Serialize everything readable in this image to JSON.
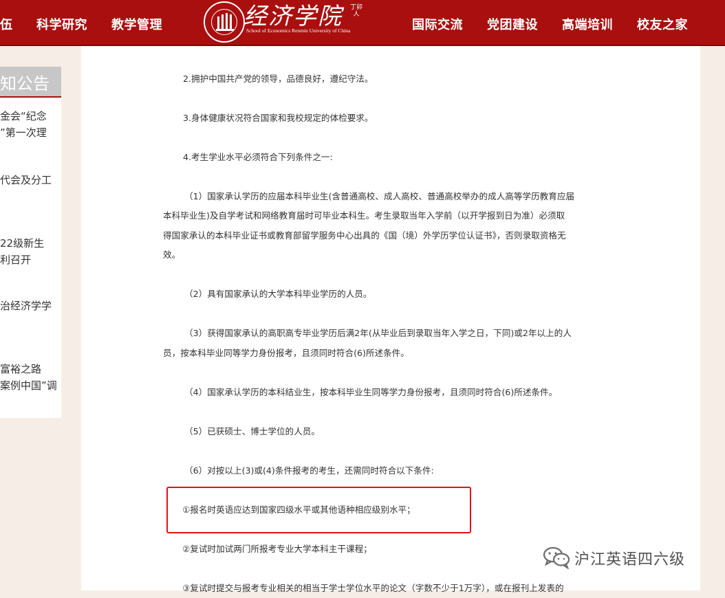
{
  "header": {
    "nav_left": [
      "伍",
      "科学研究",
      "教学管理"
    ],
    "nav_right": [
      "国际交流",
      "党团建设",
      "高端培训",
      "校友之家"
    ],
    "logo_title": "经济学院",
    "logo_subtitle": "School of Economics Renmin University of China",
    "logo_seal": "丁卯人",
    "colors": {
      "brand": "#a90f0f",
      "background": "#f6eee6"
    }
  },
  "sidebar": {
    "heading": "知公告",
    "items": [
      [
        "金会“纪念",
        "”第一次理"
      ],
      [
        "代会及分工"
      ],
      [
        "22级新生",
        "利召开"
      ],
      [
        "治经济学学"
      ],
      [
        "富裕之路",
        "案例中国”调"
      ]
    ]
  },
  "article": {
    "paragraphs": [
      [
        "2.拥护中国共产党的领导，品德良好，遵纪守法。"
      ],
      [
        "3.身体健康状况符合国家和我校规定的体检要求。"
      ],
      [
        "4.考生学业水平必须符合下列条件之一:"
      ],
      [
        "（1）国家承认学历的应届本科毕业生(含普通高校、成人高校、普通高校举办的成人高等学历教育应届",
        "本科毕业生)及自学考试和网络教育届时可毕业本科生。考生录取当年入学前（以开学报到日为准）必须取",
        "得国家承认的本科毕业证书或教育部留学服务中心出具的《国（境）外学历学位认证书》，否则录取资格无",
        "效。"
      ],
      [
        "（2）具有国家承认的大学本科毕业学历的人员。"
      ],
      [
        "（3）获得国家承认的高职高专毕业学历后满2年(从毕业后到录取当年入学之日，下同)或2年以上的人",
        "员，按本科毕业同等学力身份报考，且须同时符合(6)所述条件。"
      ],
      [
        "（4）国家承认学历的本科结业生，按本科毕业生同等学力身份报考，且须同时符合(6)所述条件。"
      ],
      [
        "（5）已获硕士、博士学位的人员。"
      ],
      [
        "（6）对按以上(3)或(4)条件报考的考生，还需同时符合以下条件:"
      ],
      [
        "①报名时英语应达到国家四级水平或其他语种相应级别水平；"
      ],
      [
        "②复试时加试两门所报考专业大学本科主干课程；"
      ],
      [
        "③复试时提交与报考专业相关的相当于学士学位水平的论文（字数不少于1万字），或在报刊上发表的"
      ]
    ]
  },
  "watermark": {
    "text": "沪江英语四六级",
    "icon": "wechat-icon"
  }
}
